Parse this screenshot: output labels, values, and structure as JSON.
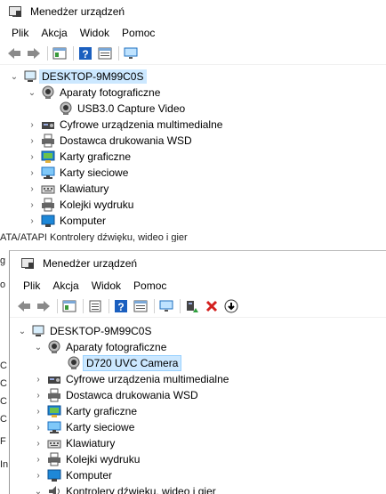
{
  "windows": [
    {
      "title": "Menedżer urządzeń",
      "menu": [
        "Plik",
        "Akcja",
        "Widok",
        "Pomoc"
      ],
      "tree": {
        "root": "DESKTOP-9M99C0S",
        "items": [
          {
            "label": "Aparaty fotograficzne",
            "expanded": true,
            "icon": "camera-icon"
          },
          {
            "label": "USB3.0 Capture Video",
            "child": true,
            "icon": "webcam-icon"
          },
          {
            "label": "Cyfrowe urządzenia multimedialne",
            "icon": "media-device-icon"
          },
          {
            "label": "Dostawca drukowania WSD",
            "icon": "printer-icon"
          },
          {
            "label": "Karty graficzne",
            "icon": "display-adapter-icon"
          },
          {
            "label": "Karty sieciowe",
            "icon": "network-adapter-icon"
          },
          {
            "label": "Klawiatury",
            "icon": "keyboard-icon"
          },
          {
            "label": "Kolejki wydruku",
            "icon": "print-queue-icon"
          },
          {
            "label": "Komputer",
            "icon": "computer-icon"
          }
        ]
      }
    },
    {
      "title": "Menedżer urządzeń",
      "menu": [
        "Plik",
        "Akcja",
        "Widok",
        "Pomoc"
      ],
      "tree": {
        "root": "DESKTOP-9M99C0S",
        "items": [
          {
            "label": "Aparaty fotograficzne",
            "expanded": true,
            "icon": "camera-icon"
          },
          {
            "label": "D720 UVC Camera",
            "child": true,
            "icon": "webcam-icon"
          },
          {
            "label": "Cyfrowe urządzenia multimedialne",
            "icon": "media-device-icon"
          },
          {
            "label": "Dostawca drukowania WSD",
            "icon": "printer-icon"
          },
          {
            "label": "Karty graficzne",
            "icon": "display-adapter-icon"
          },
          {
            "label": "Karty sieciowe",
            "icon": "network-adapter-icon"
          },
          {
            "label": "Klawiatury",
            "icon": "keyboard-icon"
          },
          {
            "label": "Kolejki wydruku",
            "icon": "print-queue-icon"
          },
          {
            "label": "Komputer",
            "icon": "computer-icon"
          },
          {
            "label": "Kontrolery dźwięku, wideo i gier",
            "icon": "sound-icon"
          }
        ]
      }
    }
  ],
  "background_fragments": {
    "left_edge": [
      "ATA/ATAPI",
      "g",
      "o",
      "C",
      "C",
      "C",
      "C",
      "F",
      "In"
    ],
    "top_edge": "ATA/ATAPI     Kontrolery dźwięku, wideo i gier"
  },
  "colors": {
    "selection": "#cce8ff",
    "icon_blue": "#1e88d8",
    "delete_red": "#d3201e",
    "enable_green": "#2e9e3c"
  }
}
